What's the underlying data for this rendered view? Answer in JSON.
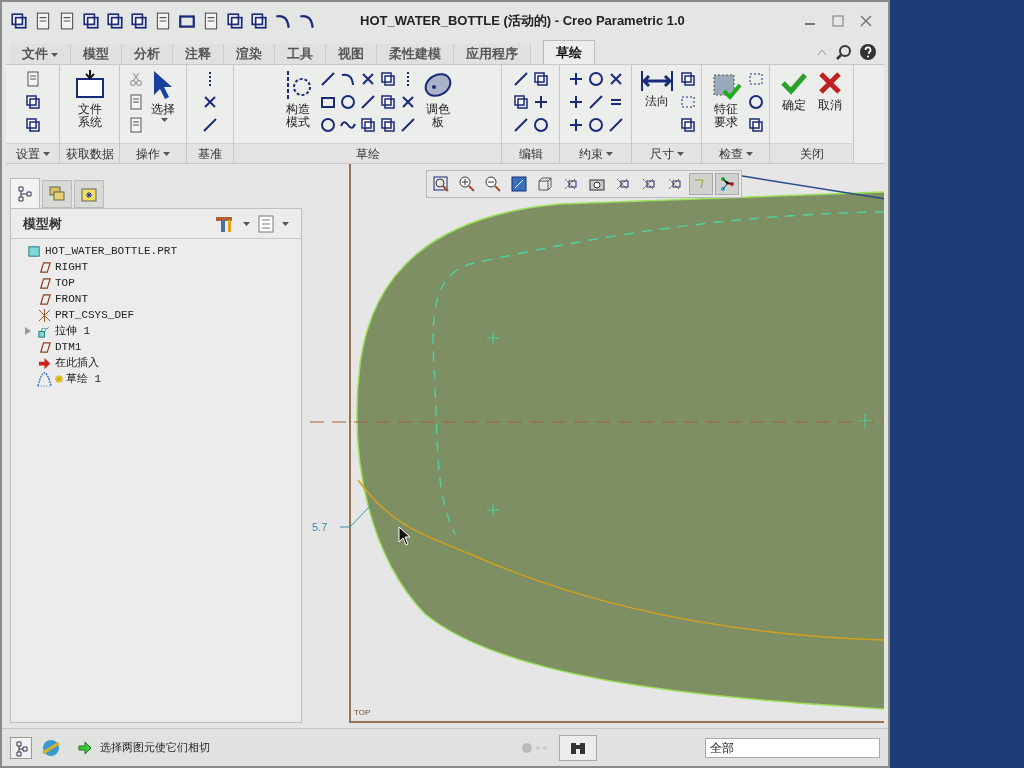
{
  "window": {
    "title": "HOT_WATER_BOTTLE (活动的) - Creo Parametric 1.0"
  },
  "tabs": [
    {
      "label": "文件",
      "selected": false,
      "dropdown": true
    },
    {
      "label": "模型",
      "selected": false,
      "dropdown": false
    },
    {
      "label": "分析",
      "selected": false,
      "dropdown": false
    },
    {
      "label": "注释",
      "selected": false,
      "dropdown": false
    },
    {
      "label": "渲染",
      "selected": false,
      "dropdown": false
    },
    {
      "label": "工具",
      "selected": false,
      "dropdown": false
    },
    {
      "label": "视图",
      "selected": false,
      "dropdown": false
    },
    {
      "label": "柔性建模",
      "selected": false,
      "dropdown": false
    },
    {
      "label": "应用程序",
      "selected": false,
      "dropdown": false
    },
    {
      "label": "草绘",
      "selected": true,
      "dropdown": false
    }
  ],
  "ribbon_groups": [
    {
      "label": "设置",
      "dropdown": true
    },
    {
      "label": "获取数据",
      "dropdown": false,
      "buttons": [
        {
          "label": "文件系统"
        }
      ]
    },
    {
      "label": "操作",
      "dropdown": true,
      "buttons": [
        {
          "label": "选择"
        }
      ]
    },
    {
      "label": "基准",
      "dropdown": false
    },
    {
      "label": "草绘",
      "dropdown": false,
      "buttons": [
        {
          "label": "构造模式"
        },
        {
          "label": "调色板"
        }
      ]
    },
    {
      "label": "编辑",
      "dropdown": false
    },
    {
      "label": "约束",
      "dropdown": true
    },
    {
      "label": "尺寸",
      "dropdown": true,
      "buttons": [
        {
          "label": "法向"
        }
      ]
    },
    {
      "label": "检查",
      "dropdown": true,
      "buttons": [
        {
          "label": "特征要求"
        }
      ]
    },
    {
      "label": "关闭",
      "dropdown": false,
      "buttons": [
        {
          "label": "确定"
        },
        {
          "label": "取消"
        }
      ]
    }
  ],
  "model_tree": {
    "tabs": [
      {
        "selected": true
      },
      {
        "selected": false
      },
      {
        "selected": false
      }
    ],
    "title": "模型树",
    "items": [
      {
        "label": "HOT_WATER_BOTTLE.PRT",
        "kind": "part",
        "collapsed": false,
        "children": [
          {
            "label": "RIGHT",
            "kind": "plane",
            "collapsed": false
          },
          {
            "label": "TOP",
            "kind": "plane",
            "collapsed": false
          },
          {
            "label": "FRONT",
            "kind": "plane",
            "collapsed": false
          },
          {
            "label": "PRT_CSYS_DEF",
            "kind": "csys",
            "collapsed": false
          },
          {
            "label": "拉伸 1",
            "kind": "feature",
            "collapsed": true
          },
          {
            "label": "DTM1",
            "kind": "plane",
            "collapsed": false
          },
          {
            "label": "在此插入",
            "kind": "insert",
            "collapsed": false
          },
          {
            "label": "草绘 1",
            "kind": "sketch",
            "collapsed": false
          }
        ]
      }
    ]
  },
  "canvas": {
    "dimension": "5.7",
    "datum_label": "TOP"
  },
  "status_bar": {
    "message": "选择两图元使它们相切",
    "filter": "全部"
  }
}
